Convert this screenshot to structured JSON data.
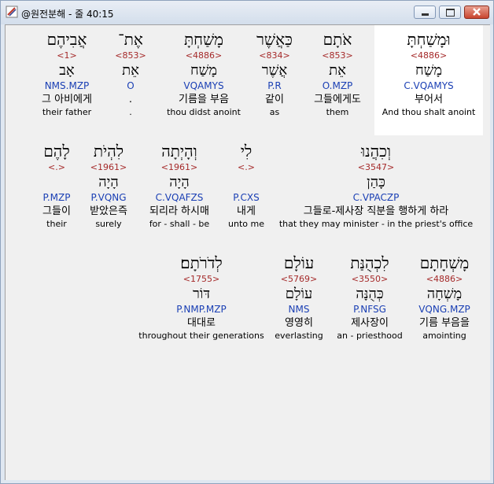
{
  "window": {
    "title": "@원전분해 - 줄 40:15"
  },
  "rows": [
    [
      {
        "heb": "וּמָשַׁחְתָּ",
        "num": "<4886>",
        "lemma": "מָשַׁח",
        "morph": "C.VQAMYS",
        "kor": "부어서",
        "eng": "And thou shalt anoint",
        "selected": true
      },
      {
        "heb": "אֹתָם",
        "num": "<853>",
        "lemma": "אֵת",
        "morph": "O.MZP",
        "kor": "그들에게도",
        "eng": "them"
      },
      {
        "heb": "כַּאֲשֶׁר",
        "num": "<834>",
        "lemma": "אֲשֶׁר",
        "morph": "P.R",
        "kor": "같이",
        "eng": "as"
      },
      {
        "heb": "מָשַׁחְתָּ",
        "num": "<4886>",
        "lemma": "מָשַׁח",
        "morph": "VQAMYS",
        "kor": "기름을 부음",
        "eng": "thou didst anoint"
      },
      {
        "heb": "אֶת־",
        "num": "<853>",
        "lemma": "אֵת",
        "morph": "O",
        "kor": ".",
        "eng": "."
      },
      {
        "heb": "אֲבִיהֶם",
        "num": "<1>",
        "lemma": "אָב",
        "morph": "NMS.MZP",
        "kor": "그 아비에게",
        "eng": "their father"
      }
    ],
    [
      {
        "heb": "וְכִהֲנוּ",
        "num": "<3547>",
        "lemma": "כָּהַן",
        "morph": "C.VPACZP",
        "kor": "그들로-제사장 직분을 행하게 하라",
        "eng": "that they may minister - in the priest's office"
      },
      {
        "heb": "לִי",
        "num": "<.>",
        "lemma": "",
        "morph": "P.CXS",
        "kor": "내게",
        "eng": "unto me"
      },
      {
        "heb": "וְהָיְתָה",
        "num": "<1961>",
        "lemma": "הָיָה",
        "morph": "C.VQAFZS",
        "kor": "되리라 하시매",
        "eng": "for - shall - be"
      },
      {
        "heb": "לִהְיֹת",
        "num": "<1961>",
        "lemma": "הָיָה",
        "morph": "P.VQNG",
        "kor": "받았은즉",
        "eng": "surely"
      },
      {
        "heb": "לָהֶם",
        "num": "<.>",
        "lemma": "",
        "morph": "P.MZP",
        "kor": "그들이",
        "eng": "their"
      }
    ],
    [
      {
        "heb": "מָשְׁחָתָם",
        "num": "<4886>",
        "lemma": "מָשְׁחָה",
        "morph": "VQNG.MZP",
        "kor": "기름 부음을",
        "eng": "amointing"
      },
      {
        "heb": "לִכְהֻנַּת",
        "num": "<3550>",
        "lemma": "כְּהֻנָּה",
        "morph": "P.NFSG",
        "kor": "제사장이",
        "eng": "an - priesthood"
      },
      {
        "heb": "עוֹלָם",
        "num": "<5769>",
        "lemma": "עוֹלָם",
        "morph": "NMS",
        "kor": "영영히",
        "eng": "everlasting"
      },
      {
        "heb": "לְדֹרֹתָם׃",
        "num": "<1755>",
        "lemma": "דּוֹר",
        "morph": "P.NMP.MZP",
        "kor": "대대로",
        "eng": "throughout their generations"
      }
    ]
  ]
}
